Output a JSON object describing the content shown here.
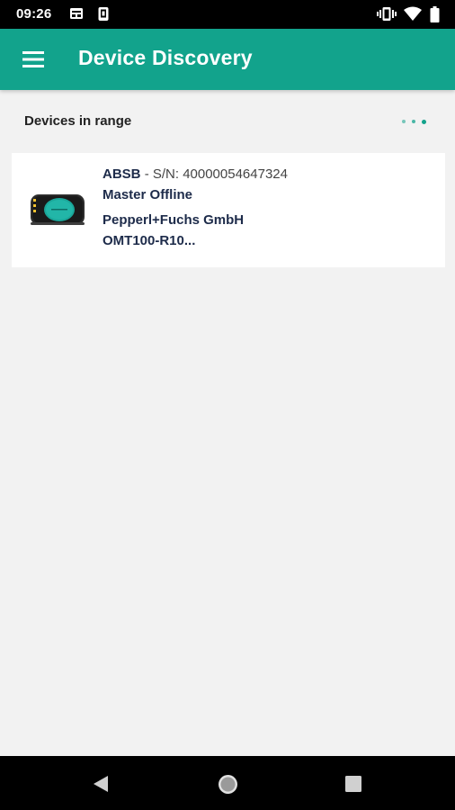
{
  "status_bar": {
    "time": "09:26",
    "left_icons": [
      "sim-card-icon",
      "device-icon"
    ],
    "right_icons": [
      "vibrate-icon",
      "wifi-icon",
      "battery-icon"
    ]
  },
  "app_bar": {
    "title": "Device Discovery",
    "menu_icon": "hamburger-menu-icon",
    "background_color": "#12a38c"
  },
  "section": {
    "title": "Devices in range",
    "loading_indicator": "three-dots-loading"
  },
  "devices": [
    {
      "name": "ABSB",
      "serial": "- S/N: 40000054647324",
      "status": "Master Offline",
      "vendor": "Pepperl+Fuchs GmbH",
      "model": "OMT100-R10...",
      "image_icon": "sensor-device-icon"
    }
  ],
  "nav_bar": {
    "back_icon": "back-triangle-icon",
    "home_icon": "home-circle-icon",
    "recents_icon": "recents-square-icon"
  }
}
